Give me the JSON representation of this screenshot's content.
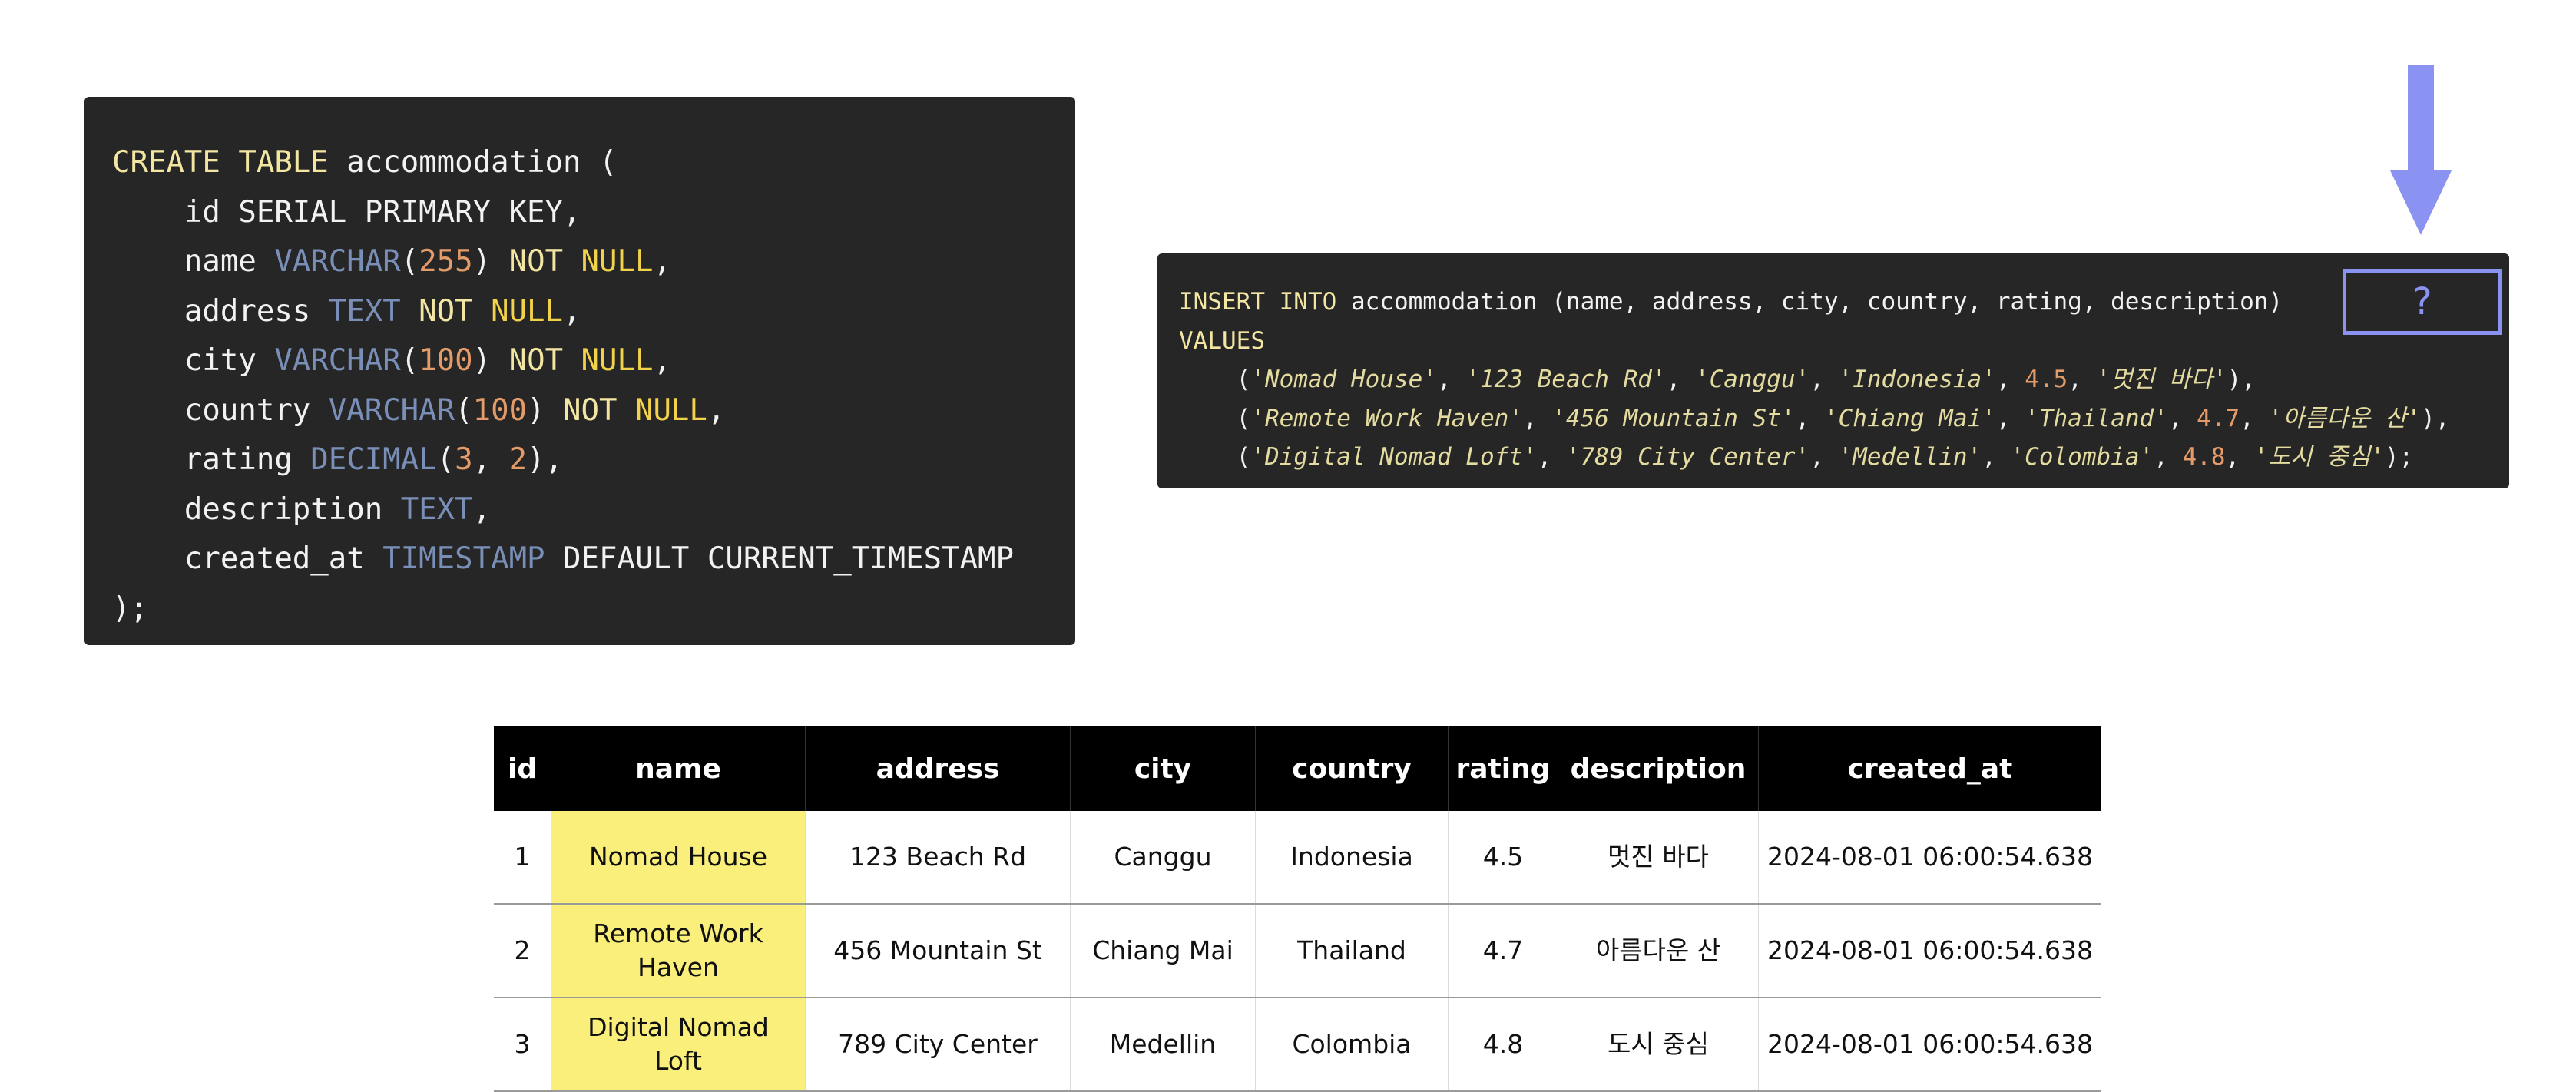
{
  "create_sql": {
    "lines": [
      [
        {
          "t": "CREATE TABLE ",
          "c": "kw"
        },
        {
          "t": "accommodation (",
          "c": "plain"
        }
      ],
      [
        {
          "t": "    id SERIAL PRIMARY KEY,",
          "c": "plain"
        }
      ],
      [
        {
          "t": "    name ",
          "c": "plain"
        },
        {
          "t": "VARCHAR",
          "c": "type"
        },
        {
          "t": "(",
          "c": "plain"
        },
        {
          "t": "255",
          "c": "num"
        },
        {
          "t": ") ",
          "c": "plain"
        },
        {
          "t": "NOT ",
          "c": "kw"
        },
        {
          "t": "NULL",
          "c": "nul"
        },
        {
          "t": ",",
          "c": "plain"
        }
      ],
      [
        {
          "t": "    address ",
          "c": "plain"
        },
        {
          "t": "TEXT ",
          "c": "type"
        },
        {
          "t": "NOT ",
          "c": "kw"
        },
        {
          "t": "NULL",
          "c": "nul"
        },
        {
          "t": ",",
          "c": "plain"
        }
      ],
      [
        {
          "t": "    city ",
          "c": "plain"
        },
        {
          "t": "VARCHAR",
          "c": "type"
        },
        {
          "t": "(",
          "c": "plain"
        },
        {
          "t": "100",
          "c": "num"
        },
        {
          "t": ") ",
          "c": "plain"
        },
        {
          "t": "NOT ",
          "c": "kw"
        },
        {
          "t": "NULL",
          "c": "nul"
        },
        {
          "t": ",",
          "c": "plain"
        }
      ],
      [
        {
          "t": "    country ",
          "c": "plain"
        },
        {
          "t": "VARCHAR",
          "c": "type"
        },
        {
          "t": "(",
          "c": "plain"
        },
        {
          "t": "100",
          "c": "num"
        },
        {
          "t": ") ",
          "c": "plain"
        },
        {
          "t": "NOT ",
          "c": "kw"
        },
        {
          "t": "NULL",
          "c": "nul"
        },
        {
          "t": ",",
          "c": "plain"
        }
      ],
      [
        {
          "t": "    rating ",
          "c": "plain"
        },
        {
          "t": "DECIMAL",
          "c": "type"
        },
        {
          "t": "(",
          "c": "plain"
        },
        {
          "t": "3",
          "c": "num"
        },
        {
          "t": ", ",
          "c": "plain"
        },
        {
          "t": "2",
          "c": "num"
        },
        {
          "t": "),",
          "c": "plain"
        }
      ],
      [
        {
          "t": "    description ",
          "c": "plain"
        },
        {
          "t": "TEXT",
          "c": "type"
        },
        {
          "t": ",",
          "c": "plain"
        }
      ],
      [
        {
          "t": "    created_at ",
          "c": "plain"
        },
        {
          "t": "TIMESTAMP ",
          "c": "type"
        },
        {
          "t": "DEFAULT CURRENT_TIMESTAMP",
          "c": "plain"
        }
      ],
      [
        {
          "t": ");",
          "c": "plain"
        }
      ]
    ]
  },
  "insert_sql": {
    "lines": [
      [
        {
          "t": "INSERT INTO ",
          "c": "kw"
        },
        {
          "t": "accommodation (name, address, city, country, rating, description)",
          "c": "plain"
        }
      ],
      [
        {
          "t": "VALUES",
          "c": "kw"
        }
      ],
      [
        {
          "t": "    (",
          "c": "plain"
        },
        {
          "t": "'Nomad House'",
          "c": "str"
        },
        {
          "t": ", ",
          "c": "plain"
        },
        {
          "t": "'123 Beach Rd'",
          "c": "str"
        },
        {
          "t": ", ",
          "c": "plain"
        },
        {
          "t": "'Canggu'",
          "c": "str"
        },
        {
          "t": ", ",
          "c": "plain"
        },
        {
          "t": "'Indonesia'",
          "c": "str"
        },
        {
          "t": ", ",
          "c": "plain"
        },
        {
          "t": "4.5",
          "c": "num"
        },
        {
          "t": ", ",
          "c": "plain"
        },
        {
          "t": "'멋진 바다'",
          "c": "str"
        },
        {
          "t": "),",
          "c": "plain"
        }
      ],
      [
        {
          "t": "    (",
          "c": "plain"
        },
        {
          "t": "'Remote Work Haven'",
          "c": "str"
        },
        {
          "t": ", ",
          "c": "plain"
        },
        {
          "t": "'456 Mountain St'",
          "c": "str"
        },
        {
          "t": ", ",
          "c": "plain"
        },
        {
          "t": "'Chiang Mai'",
          "c": "str"
        },
        {
          "t": ", ",
          "c": "plain"
        },
        {
          "t": "'Thailand'",
          "c": "str"
        },
        {
          "t": ", ",
          "c": "plain"
        },
        {
          "t": "4.7",
          "c": "num"
        },
        {
          "t": ", ",
          "c": "plain"
        },
        {
          "t": "'아름다운 산'",
          "c": "str"
        },
        {
          "t": "),",
          "c": "plain"
        }
      ],
      [
        {
          "t": "    (",
          "c": "plain"
        },
        {
          "t": "'Digital Nomad Loft'",
          "c": "str"
        },
        {
          "t": ", ",
          "c": "plain"
        },
        {
          "t": "'789 City Center'",
          "c": "str"
        },
        {
          "t": ", ",
          "c": "plain"
        },
        {
          "t": "'Medellin'",
          "c": "str"
        },
        {
          "t": ", ",
          "c": "plain"
        },
        {
          "t": "'Colombia'",
          "c": "str"
        },
        {
          "t": ", ",
          "c": "plain"
        },
        {
          "t": "4.8",
          "c": "num"
        },
        {
          "t": ", ",
          "c": "plain"
        },
        {
          "t": "'도시 중심'",
          "c": "str"
        },
        {
          "t": ");",
          "c": "plain"
        }
      ]
    ]
  },
  "question_mark": "?",
  "arrow_icon": "down-arrow-icon",
  "colors": {
    "code_bg": "#262626",
    "keyword": "#f3e6a2",
    "type": "#7a8fb8",
    "number": "#e39b6a",
    "null": "#f2d24a",
    "highlight": "#f9ef7a",
    "arrow": "#8b93f2"
  },
  "table": {
    "columns": [
      "id",
      "name",
      "address",
      "city",
      "country",
      "rating",
      "description",
      "created_at"
    ],
    "rows": [
      [
        "1",
        "Nomad House",
        "123 Beach Rd",
        "Canggu",
        "Indonesia",
        "4.5",
        "멋진 바다",
        "2024-08-01 06:00:54.638"
      ],
      [
        "2",
        "Remote Work Haven",
        "456 Mountain St",
        "Chiang Mai",
        "Thailand",
        "4.7",
        "아름다운 산",
        "2024-08-01 06:00:54.638"
      ],
      [
        "3",
        "Digital Nomad Loft",
        "789 City Center",
        "Medellin",
        "Colombia",
        "4.8",
        "도시 중심",
        "2024-08-01 06:00:54.638"
      ]
    ]
  }
}
